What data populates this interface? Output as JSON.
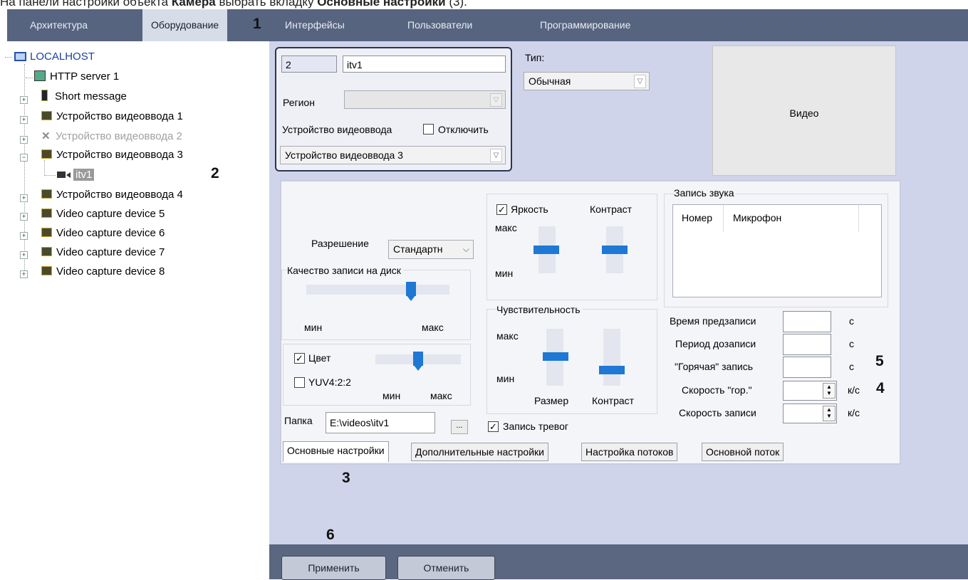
{
  "caption": {
    "prefix": "На панели настройки объекта ",
    "object": "Камера",
    "middle": " выбрать вкладку ",
    "tab": "Основные настройки",
    "suffix": " (3)."
  },
  "markers": {
    "m1": "1",
    "m2": "2",
    "m3": "3",
    "m4": "4",
    "m5": "5",
    "m6": "6"
  },
  "menu": [
    {
      "label": "Архитектура"
    },
    {
      "label": "Оборудование"
    },
    {
      "label": "Интерфейсы"
    },
    {
      "label": "Пользователи"
    },
    {
      "label": "Программирование"
    }
  ],
  "tree": {
    "root": "LOCALHOST",
    "items": [
      {
        "label": "HTTP server 1"
      },
      {
        "label": "Short message"
      },
      {
        "label": "Устройство видеоввода 1"
      },
      {
        "label": "Устройство видеоввода 2"
      },
      {
        "label": "Устройство видеоввода 3"
      },
      {
        "label": "itv1"
      },
      {
        "label": "Устройство видеоввода 4"
      },
      {
        "label": "Video capture device 5"
      },
      {
        "label": "Video capture device 6"
      },
      {
        "label": "Video capture device 7"
      },
      {
        "label": "Video capture device 8"
      }
    ]
  },
  "object": {
    "id": "2",
    "name": "itv1",
    "type_label": "Тип:",
    "type_value": "Обычная",
    "region_label": "Регион",
    "device_label": "Устройство видеоввода",
    "disable_label": "Отключить",
    "device_value": "Устройство видеоввода 3",
    "video_label": "Видео"
  },
  "settings": {
    "resolution_label": "Разрешение",
    "resolution_value": "Стандартн",
    "quality_label": "Качество записи на диск",
    "min": "мин",
    "max": "макс",
    "color_label": "Цвет",
    "yuv_label": "YUV4:2:2",
    "brightness_label": "Яркость",
    "contrast_label": "Контраст",
    "sensitivity_label": "Чувствительность",
    "size_label": "Размер",
    "folder_label": "Папка",
    "folder_value": "E:\\videos\\itv1",
    "browse_label": "...",
    "alarm_label": "Запись тревог",
    "audio_label": "Запись звука",
    "audio_col1": "Номер",
    "audio_col2": "Микрофон",
    "prerecord_label": "Время предзаписи",
    "postrecord_label": "Период дозаписи",
    "hot_label": "\"Горячая\" запись",
    "hot_speed_label": "Скорость \"гор.\"",
    "rec_speed_label": "Скорость записи",
    "unit_s": "с",
    "unit_fps": "к/с"
  },
  "tabs": [
    {
      "label": "Основные настройки"
    },
    {
      "label": "Дополнительные настройки"
    },
    {
      "label": "Настройка потоков"
    },
    {
      "label": "Основной поток"
    }
  ],
  "buttons": {
    "apply": "Применить",
    "cancel": "Отменить"
  },
  "state": {
    "disable_checked": false,
    "brightness_checked": true,
    "color_checked": true,
    "yuv_checked": false,
    "alarm_checked": true
  }
}
